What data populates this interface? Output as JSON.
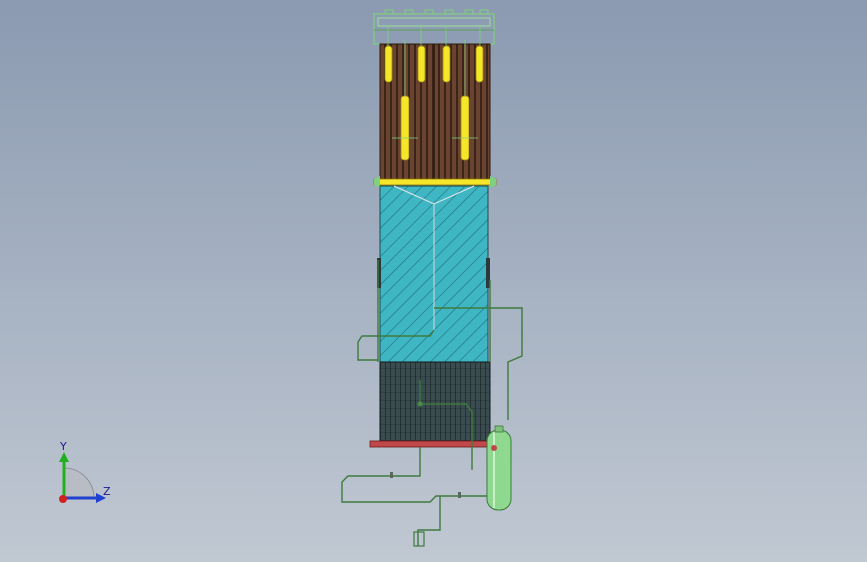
{
  "viewport": {
    "background_top": "#8b9ab1",
    "background_bottom": "#c0c8d2",
    "model": {
      "colors": {
        "tube_bank": "#5a3a28",
        "header_yellow": "#f5e62a",
        "teal_section": "#3fb6c4",
        "lower_grid": "#2c3c40",
        "base_plate": "#c0484a",
        "pipe_green": "#3e7a3e",
        "vessel_green": "#8fd88f",
        "frame_green": "#7fd07f"
      }
    }
  },
  "triad": {
    "y_label": "Y",
    "z_label": "Z",
    "colors": {
      "y": "#22b022",
      "z": "#2040d0",
      "x": "#d02020"
    }
  }
}
